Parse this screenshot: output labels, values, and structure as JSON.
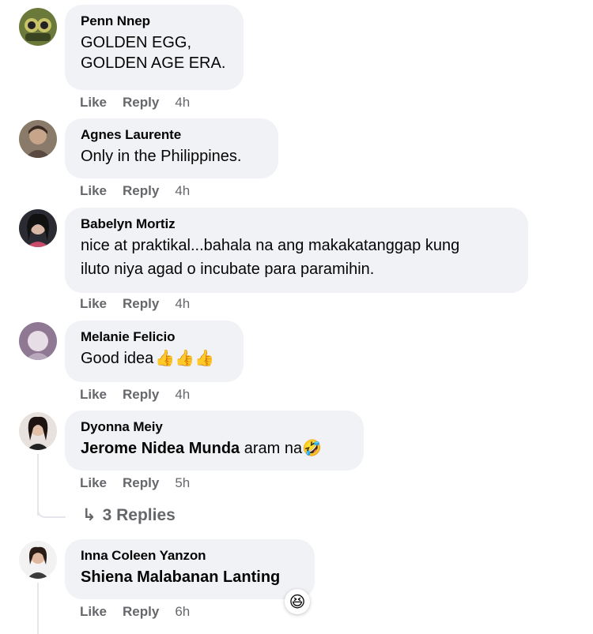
{
  "comments": [
    {
      "author": "Penn Nnep",
      "lines": [
        "GOLDEN EGG,",
        "GOLDEN AGE ERA."
      ],
      "like": "Like",
      "reply": "Reply",
      "time": "4h"
    },
    {
      "author": "Agnes Laurente",
      "lines": [
        "Only in the Philippines."
      ],
      "like": "Like",
      "reply": "Reply",
      "time": "4h"
    },
    {
      "author": "Babelyn Mortiz",
      "lines": [
        "nice at praktikal...bahala na ang makakatanggap kung",
        "iluto niya agad o incubate para paramihin."
      ],
      "like": "Like",
      "reply": "Reply",
      "time": "4h"
    },
    {
      "author": "Melanie Felicio",
      "lines": [
        "Good idea"
      ],
      "like": "Like",
      "reply": "Reply",
      "time": "4h"
    },
    {
      "author": "Dyonna Meiy",
      "mention": "Jerome Nidea Munda",
      "after": " aram na",
      "like": "Like",
      "reply": "Reply",
      "time": "5h"
    },
    {
      "author": "Inna Coleen Yanzon",
      "mention": "Shiena Malabanan Lanting",
      "like": "Like",
      "reply": "Reply",
      "time": "6h"
    }
  ],
  "replies_link": "3 Replies",
  "icons": {
    "thumbs_up": "thumbs-up-emoji",
    "laugh": "laughing-emoji",
    "reply_arrow": "reply-arrow-icon"
  }
}
